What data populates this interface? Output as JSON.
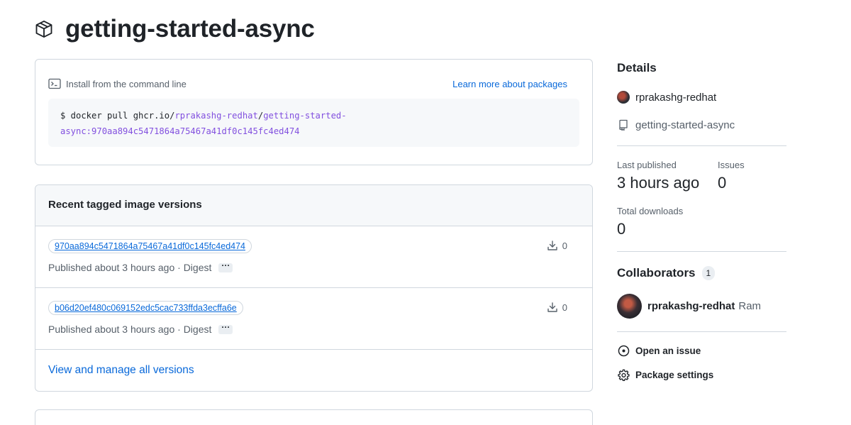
{
  "header": {
    "title": "getting-started-async",
    "icon": "package-icon"
  },
  "install": {
    "label": "Install from the command line",
    "learn_more": "Learn more about packages",
    "cmd_prefix": "$ docker pull ghcr.io/",
    "cmd_owner": "rprakashg-redhat",
    "cmd_sep": "/",
    "cmd_image_line1": "getting-started-",
    "cmd_image_line2": "async:970aa894c5471864a75467a41df0c145fc4ed474"
  },
  "versions": {
    "heading": "Recent tagged image versions",
    "items": [
      {
        "tag": "970aa894c5471864a75467a41df0c145fc4ed474",
        "downloads": "0",
        "meta": "Published about 3 hours ago · Digest",
        "more": "···"
      },
      {
        "tag": "b06d20ef480c069152edc5cac733ffda3ecffa6e",
        "downloads": "0",
        "meta": "Published about 3 hours ago · Digest",
        "more": "···"
      }
    ],
    "view_all": "View and manage all versions"
  },
  "details": {
    "heading": "Details",
    "owner": "rprakashg-redhat",
    "repo": "getting-started-async",
    "last_published_label": "Last published",
    "last_published_value": "3 hours ago",
    "issues_label": "Issues",
    "issues_value": "0",
    "downloads_label": "Total downloads",
    "downloads_value": "0"
  },
  "collaborators": {
    "heading": "Collaborators",
    "count": "1",
    "login": "rprakashg-redhat",
    "name": "Ram"
  },
  "actions": {
    "open_issue": "Open an issue",
    "settings": "Package settings"
  },
  "colors": {
    "link": "#0969da",
    "accent_purple": "#8250df",
    "border": "#d0d7de",
    "muted": "#57606a"
  }
}
